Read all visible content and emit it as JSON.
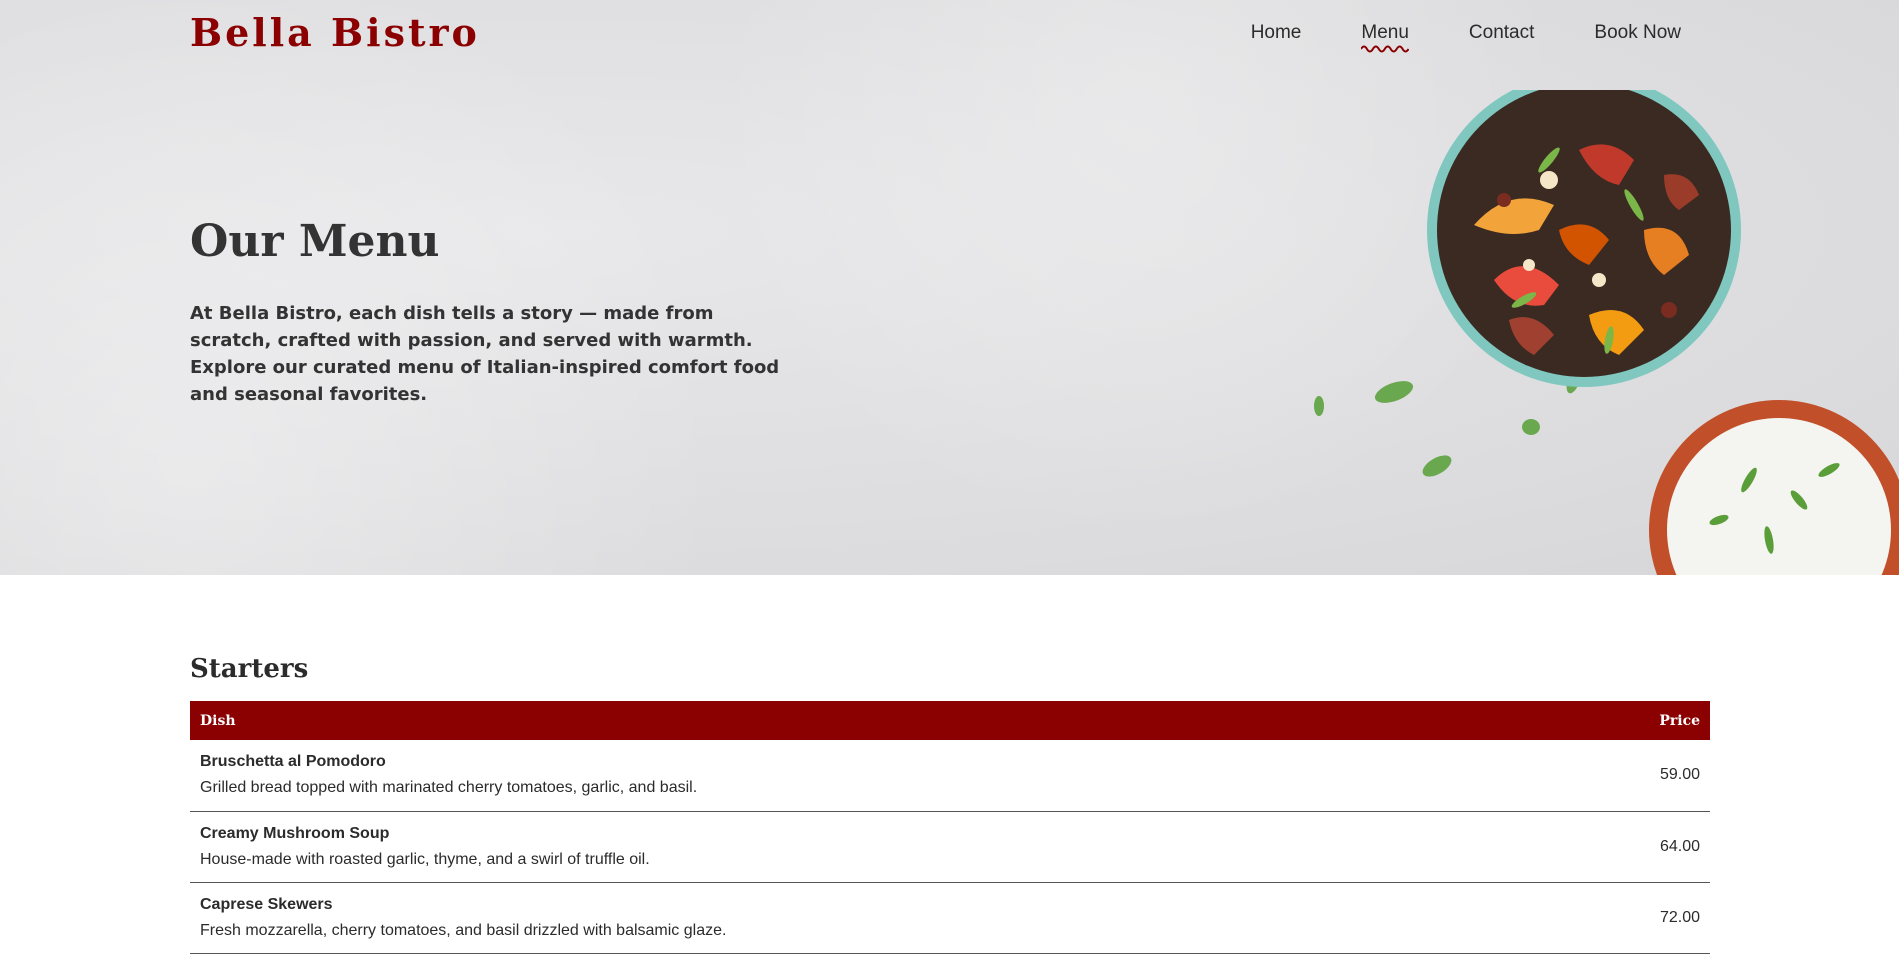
{
  "brand": {
    "name": "Bella Bistro",
    "accent": "#8b0000"
  },
  "nav": {
    "items": [
      {
        "label": "Home",
        "active": false
      },
      {
        "label": "Menu",
        "active": true
      },
      {
        "label": "Contact",
        "active": false
      },
      {
        "label": "Book Now",
        "active": false
      }
    ]
  },
  "hero": {
    "title": "Our Menu",
    "text": "At Bella Bistro, each dish tells a story — made from scratch, crafted with passion, and served with warmth. Explore our curated menu of Italian-inspired comfort food and seasonal favorites."
  },
  "starters": {
    "title": "Starters",
    "headers": {
      "dish": "Dish",
      "price": "Price"
    },
    "rows": [
      {
        "name": "Bruschetta al Pomodoro",
        "description": "Grilled bread topped with marinated cherry tomatoes, garlic, and basil.",
        "price": "59.00"
      },
      {
        "name": "Creamy Mushroom Soup",
        "description": "House-made with roasted garlic, thyme, and a swirl of truffle oil.",
        "price": "64.00"
      },
      {
        "name": "Caprese Skewers",
        "description": "Fresh mozzarella, cherry tomatoes, and basil drizzled with balsamic glaze.",
        "price": "72.00"
      }
    ]
  }
}
